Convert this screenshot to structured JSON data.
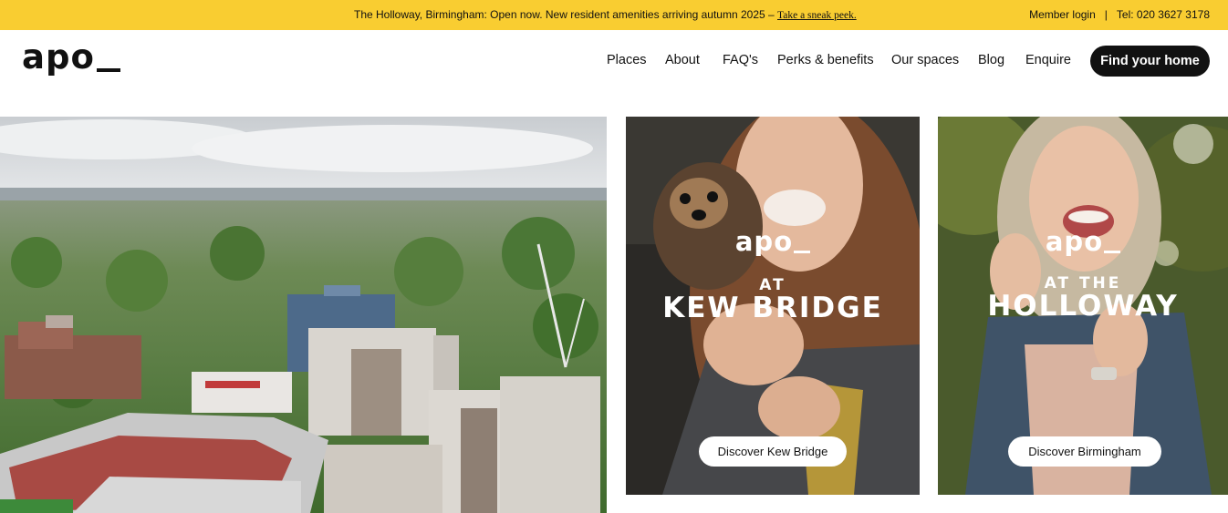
{
  "announcement": {
    "message": "The Holloway, Birmingham: Open now. New resident amenities arriving autumn 2025 – ",
    "link": "Take a sneak peek.",
    "member_login": "Member login",
    "separator": "|",
    "phone": "Tel: 020 3627 3178"
  },
  "logo": {
    "text": "apo"
  },
  "nav": {
    "items": [
      "Places",
      "About",
      "FAQ's",
      "Perks & benefits",
      "Our spaces",
      "Blog",
      "Enquire"
    ],
    "cta": "Find your home"
  },
  "cards": [
    {
      "brand": "apo",
      "at": "AT",
      "place": "KEW BRIDGE",
      "button": "Discover Kew Bridge"
    },
    {
      "brand": "apo",
      "at": "AT THE",
      "place": "HOLLOWAY",
      "button": "Discover Birmingham"
    }
  ],
  "colors": {
    "accent_yellow": "#f9cd31",
    "dark": "#111111",
    "white": "#ffffff"
  }
}
